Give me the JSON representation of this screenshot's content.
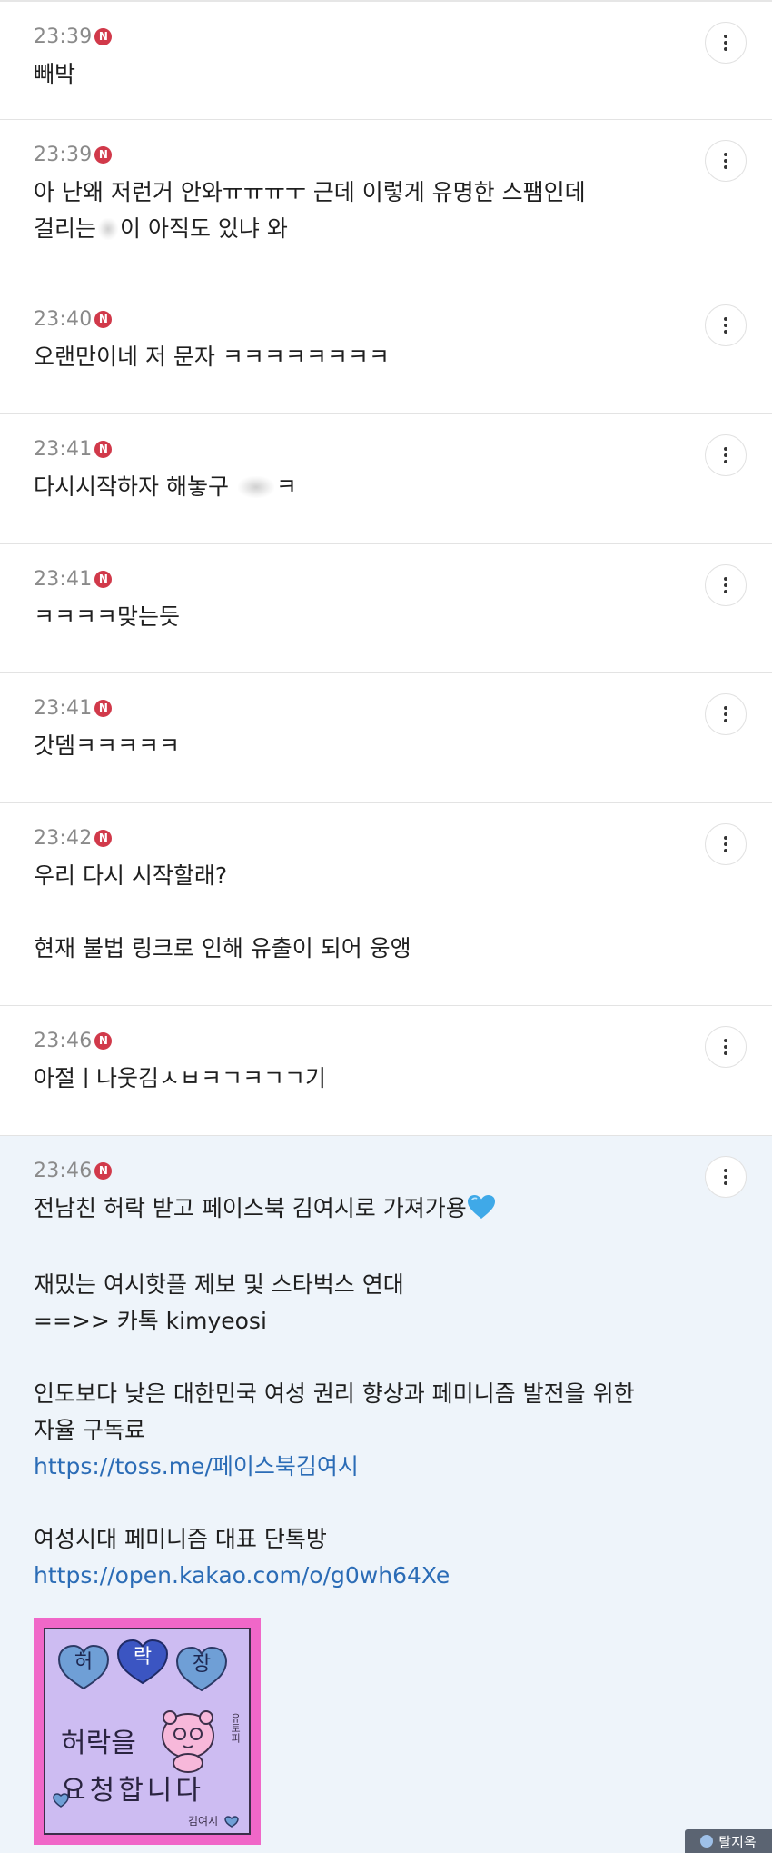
{
  "colors": {
    "badge": "#d1394a",
    "link": "#2b6cb6",
    "highlight_bg": "#eef4fa"
  },
  "comments": [
    {
      "time": "23:39",
      "badge": "N",
      "lines": [
        "빼박"
      ]
    },
    {
      "time": "23:39",
      "badge": "N",
      "lines": [
        "아 난왜 저런거 안와ㅠㅠㅠㅜ 근데 이렇게 유명한 스팸인데",
        "걸리는",
        "이 아직도 있냐 와"
      ]
    },
    {
      "time": "23:40",
      "badge": "N",
      "lines": [
        "오랜만이네 저 문자 ㅋㅋㅋㅋㅋㅋㅋㅋ"
      ]
    },
    {
      "time": "23:41",
      "badge": "N",
      "lines": [
        "다시시작하자 해놓구 ",
        "ㅋ"
      ]
    },
    {
      "time": "23:41",
      "badge": "N",
      "lines": [
        "ㅋㅋㅋㅋ맞는듯"
      ]
    },
    {
      "time": "23:41",
      "badge": "N",
      "lines": [
        "갓뎀ㅋㅋㅋㅋㅋ"
      ]
    },
    {
      "time": "23:42",
      "badge": "N",
      "lines": [
        "우리 다시 시작할래?",
        "현재 불법 링크로 인해 유출이 되어 웅앵"
      ]
    },
    {
      "time": "23:46",
      "badge": "N",
      "lines": [
        "아절ㅣ나웃김ㅅㅂㅋㄱㅋㄱㄱ기"
      ]
    },
    {
      "time": "23:46",
      "badge": "N",
      "lines": [
        "전남친 허락 받고 페이스북 김여시로 가져가용",
        "재밌는 여시핫플 제보 및 스타벅스 연대",
        "==>> 카톡 kimyeosi",
        "인도보다 낮은 대한민국 여성 권리 향상과 페미니즘 발전을 위한",
        "자율 구독료",
        "https://toss.me/페이스북김여시",
        "여성시대 페미니즘 대표 단톡방",
        "https://open.kakao.com/o/g0wh64Xe"
      ],
      "sticker": {
        "hearts": [
          "허",
          "락",
          "장"
        ],
        "line1": "허락을",
        "line2": "요청합니다",
        "side_text": "유토피",
        "signature": "김여시"
      }
    }
  ],
  "more_icon": "vertical-dots-icon",
  "watermark": "탈지옥"
}
